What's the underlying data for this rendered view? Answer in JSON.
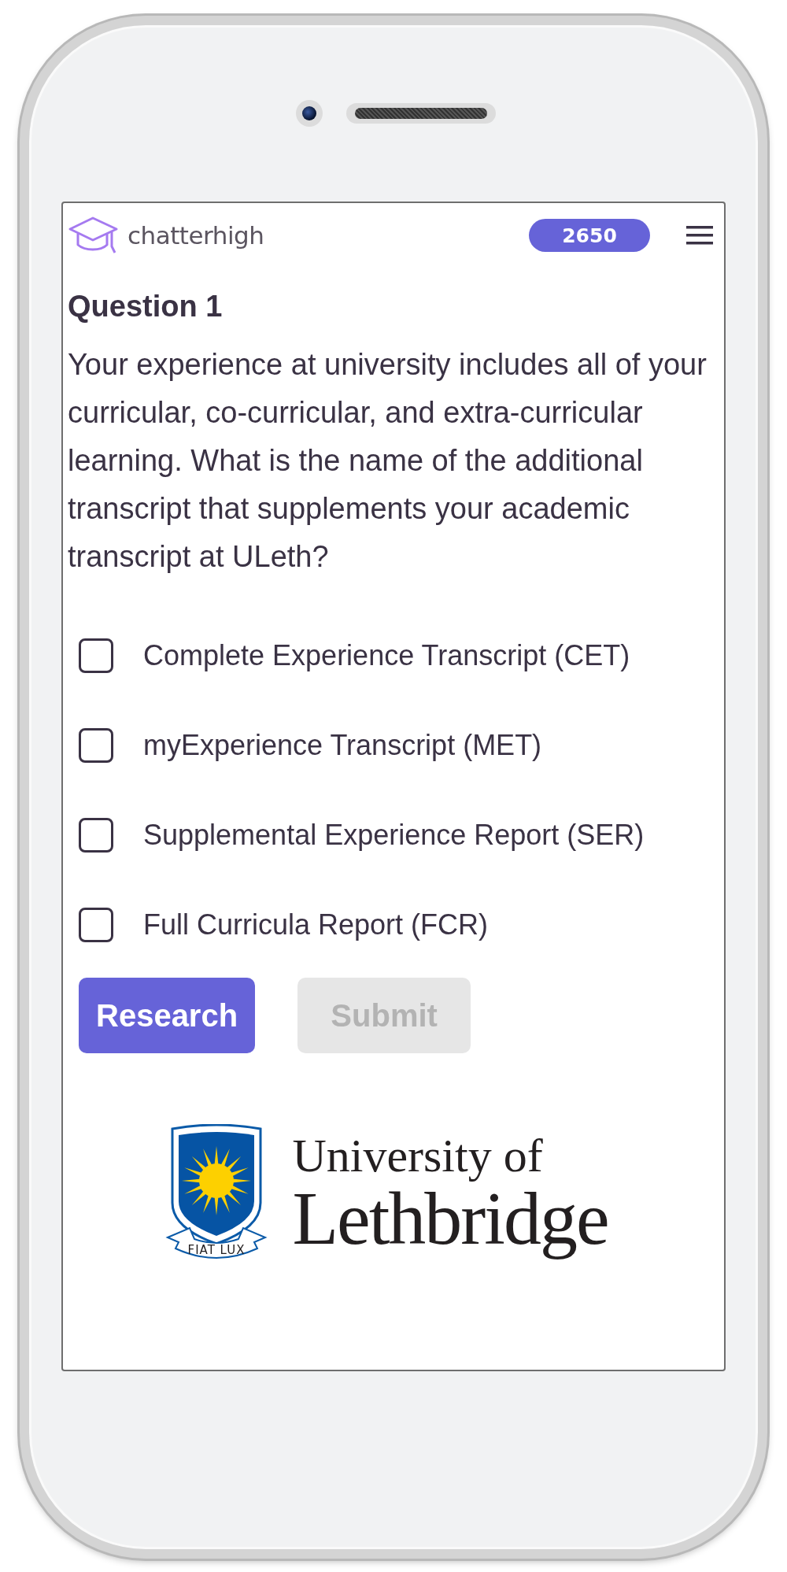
{
  "app": {
    "brand": "chatterhigh",
    "points": "2650"
  },
  "question": {
    "title": "Question 1",
    "text": "Your experience at university includes all of your curricular, co-curricular, and extra-curricular learning. What is the name of the additional transcript that supplements your academic transcript at ULeth?"
  },
  "options": [
    {
      "label": "Complete Experience Transcript (CET)",
      "checked": false
    },
    {
      "label": "myExperience Transcript (MET)",
      "checked": false
    },
    {
      "label": "Supplemental Experience Report (SER)",
      "checked": false
    },
    {
      "label": "Full Curricula Report (FCR)",
      "checked": false
    }
  ],
  "buttons": [
    {
      "label": "Research",
      "disabled": false
    },
    {
      "label": "Submit",
      "disabled": true
    }
  ],
  "sponsor": {
    "motto": "FIAT LUX",
    "name_line_1": "University of",
    "name_line_2": "Lethbridge"
  }
}
